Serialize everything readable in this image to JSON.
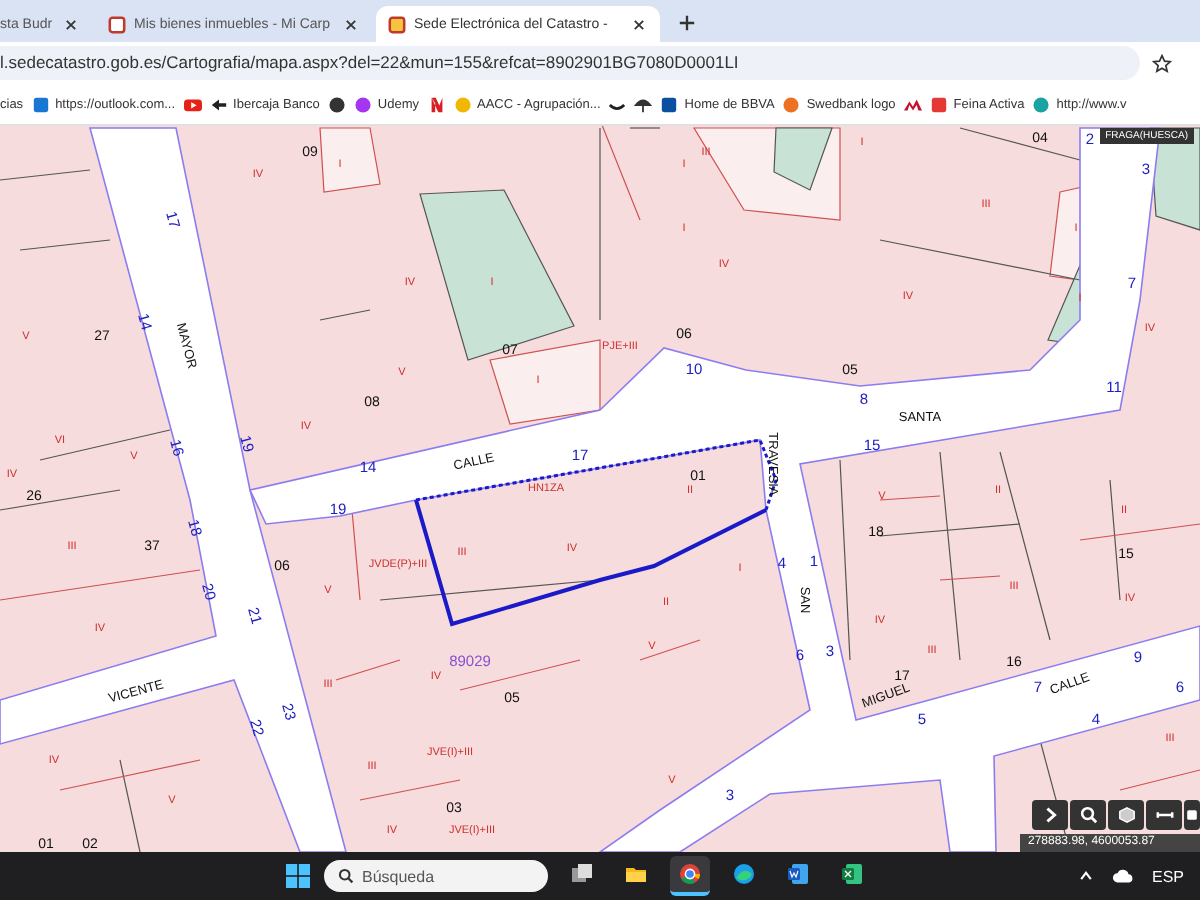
{
  "browser": {
    "tabs": [
      {
        "title": "sta Budr",
        "selected": false,
        "favicon": false
      },
      {
        "title": "Mis bienes inmuebles - Mi Carp",
        "selected": false,
        "favicon": true
      },
      {
        "title": "Sede Electrónica del Catastro -",
        "selected": true,
        "favicon": true
      }
    ],
    "address": "l.sedecatastro.gob.es/Cartografia/mapa.aspx?del=22&mun=155&refcat=8902901BG7080D0001LI",
    "bookmarks": [
      {
        "kind": "text",
        "label": "cias"
      },
      {
        "kind": "icon_text",
        "label": "https://outlook.com..."
      },
      {
        "kind": "icon"
      },
      {
        "kind": "icon_text",
        "label": "Ibercaja Banco"
      },
      {
        "kind": "icon"
      },
      {
        "kind": "icon_text",
        "label": "Udemy"
      },
      {
        "kind": "icon"
      },
      {
        "kind": "icon_text",
        "label": "AACC - Agrupación..."
      },
      {
        "kind": "icon"
      },
      {
        "kind": "icon"
      },
      {
        "kind": "icon_text",
        "label": "Home de BBVA"
      },
      {
        "kind": "icon_text",
        "label": "Swedbank logo"
      },
      {
        "kind": "icon"
      },
      {
        "kind": "icon_text",
        "label": "Feina Activa"
      },
      {
        "kind": "icon_text",
        "label": "http://www.v"
      }
    ]
  },
  "map": {
    "region_label": "FRAGA(HUESCA)",
    "coordinates": "278883.98, 4600053.87",
    "labels": [
      {
        "kind": "parcel",
        "text": "09"
      },
      {
        "kind": "floors",
        "text": "I"
      },
      {
        "kind": "floors",
        "text": "IV"
      },
      {
        "kind": "street_number",
        "text": "17"
      },
      {
        "kind": "floors",
        "text": "IV"
      },
      {
        "kind": "floors",
        "text": "I"
      },
      {
        "kind": "street_name",
        "text": "MAYOR"
      },
      {
        "kind": "street_number",
        "text": "14"
      },
      {
        "kind": "floors",
        "text": "V"
      },
      {
        "kind": "parcel",
        "text": "27"
      },
      {
        "kind": "parcel",
        "text": "07"
      },
      {
        "kind": "floors",
        "text": "V"
      },
      {
        "kind": "floors",
        "text": "I"
      },
      {
        "kind": "parcel",
        "text": "08"
      },
      {
        "kind": "floors",
        "text": "IV"
      },
      {
        "kind": "street_number",
        "text": "16"
      },
      {
        "kind": "street_number",
        "text": "19"
      },
      {
        "kind": "floors",
        "text": "VI"
      },
      {
        "kind": "floors",
        "text": "IV"
      },
      {
        "kind": "street_number",
        "text": "14"
      },
      {
        "kind": "street_name",
        "text": "CALLE"
      },
      {
        "kind": "street_number",
        "text": "17"
      },
      {
        "kind": "parcel",
        "text": "26"
      },
      {
        "kind": "floors",
        "text": "V"
      },
      {
        "kind": "street_number",
        "text": "19"
      },
      {
        "kind": "floors",
        "text": "HN1ZA"
      },
      {
        "kind": "floors",
        "text": "III"
      },
      {
        "kind": "floors",
        "text": "I"
      },
      {
        "kind": "parcel",
        "text": "04"
      },
      {
        "kind": "street_number",
        "text": "2"
      },
      {
        "kind": "floors",
        "text": "I"
      },
      {
        "kind": "street_number",
        "text": "3"
      },
      {
        "kind": "floors",
        "text": "III"
      },
      {
        "kind": "floors",
        "text": "I"
      },
      {
        "kind": "floors",
        "text": "IV"
      },
      {
        "kind": "floors",
        "text": "I"
      },
      {
        "kind": "floors",
        "text": "IV"
      },
      {
        "kind": "floors",
        "text": "I"
      },
      {
        "kind": "street_number",
        "text": "7"
      },
      {
        "kind": "floors",
        "text": "IV"
      },
      {
        "kind": "parcel",
        "text": "06"
      },
      {
        "kind": "floors",
        "text": "PJE+III"
      },
      {
        "kind": "street_number",
        "text": "10"
      },
      {
        "kind": "parcel",
        "text": "05"
      },
      {
        "kind": "street_number",
        "text": "11"
      },
      {
        "kind": "street_number",
        "text": "8"
      },
      {
        "kind": "street_name",
        "text": "SANTA"
      },
      {
        "kind": "street_number",
        "text": "15"
      },
      {
        "kind": "street_name",
        "text": "TRAVESIA"
      },
      {
        "kind": "parcel",
        "text": "01"
      },
      {
        "kind": "floors",
        "text": "II"
      },
      {
        "kind": "floors",
        "text": "V"
      },
      {
        "kind": "floors",
        "text": "II"
      },
      {
        "kind": "floors",
        "text": "II"
      },
      {
        "kind": "street_number",
        "text": "18"
      },
      {
        "kind": "floors",
        "text": "III"
      },
      {
        "kind": "parcel",
        "text": "37"
      },
      {
        "kind": "floors",
        "text": "III"
      },
      {
        "kind": "floors",
        "text": "IV"
      },
      {
        "kind": "street_number",
        "text": "20"
      },
      {
        "kind": "parcel",
        "text": "06"
      },
      {
        "kind": "floors",
        "text": "V"
      },
      {
        "kind": "floors",
        "text": "JVDE(P)+III"
      },
      {
        "kind": "street_number",
        "text": "21"
      },
      {
        "kind": "floors",
        "text": "IV"
      },
      {
        "kind": "block",
        "text": "89029"
      },
      {
        "kind": "floors",
        "text": "IV"
      },
      {
        "kind": "parcel",
        "text": "05"
      },
      {
        "kind": "street_name",
        "text": "VICENTE"
      },
      {
        "kind": "floors",
        "text": "III"
      },
      {
        "kind": "street_number",
        "text": "22"
      },
      {
        "kind": "street_number",
        "text": "23"
      },
      {
        "kind": "floors",
        "text": "IV"
      },
      {
        "kind": "floors",
        "text": "JVE(I)+III"
      },
      {
        "kind": "floors",
        "text": "III"
      },
      {
        "kind": "floors",
        "text": "V"
      },
      {
        "kind": "parcel",
        "text": "03"
      },
      {
        "kind": "floors",
        "text": "IV"
      },
      {
        "kind": "floors",
        "text": "JVE(I)+III"
      },
      {
        "kind": "parcel",
        "text": "01"
      },
      {
        "kind": "parcel",
        "text": "02"
      },
      {
        "kind": "parcel",
        "text": "18"
      },
      {
        "kind": "parcel",
        "text": "15"
      },
      {
        "kind": "street_number",
        "text": "4"
      },
      {
        "kind": "street_number",
        "text": "1"
      },
      {
        "kind": "floors",
        "text": "III"
      },
      {
        "kind": "floors",
        "text": "I"
      },
      {
        "kind": "floors",
        "text": "IV"
      },
      {
        "kind": "floors",
        "text": "II"
      },
      {
        "kind": "street_name",
        "text": "SAN"
      },
      {
        "kind": "floors",
        "text": "IV"
      },
      {
        "kind": "floors",
        "text": "III"
      },
      {
        "kind": "floors",
        "text": "V"
      },
      {
        "kind": "street_number",
        "text": "6"
      },
      {
        "kind": "street_number",
        "text": "3"
      },
      {
        "kind": "parcel",
        "text": "16"
      },
      {
        "kind": "street_number",
        "text": "9"
      },
      {
        "kind": "parcel",
        "text": "17"
      },
      {
        "kind": "street_name",
        "text": "MIGUEL"
      },
      {
        "kind": "street_number",
        "text": "7"
      },
      {
        "kind": "street_name",
        "text": "CALLE"
      },
      {
        "kind": "street_number",
        "text": "5"
      },
      {
        "kind": "street_number",
        "text": "6"
      },
      {
        "kind": "street_number",
        "text": "4"
      },
      {
        "kind": "floors",
        "text": "III"
      },
      {
        "kind": "floors",
        "text": "V"
      },
      {
        "kind": "street_number",
        "text": "3"
      }
    ]
  },
  "taskbar": {
    "search_placeholder": "Búsqueda",
    "apps": [
      {
        "selected": false
      },
      {
        "selected": false
      },
      {
        "selected": true
      },
      {
        "selected": false
      },
      {
        "selected": false
      },
      {
        "selected": false
      }
    ],
    "language": "ESP"
  }
}
